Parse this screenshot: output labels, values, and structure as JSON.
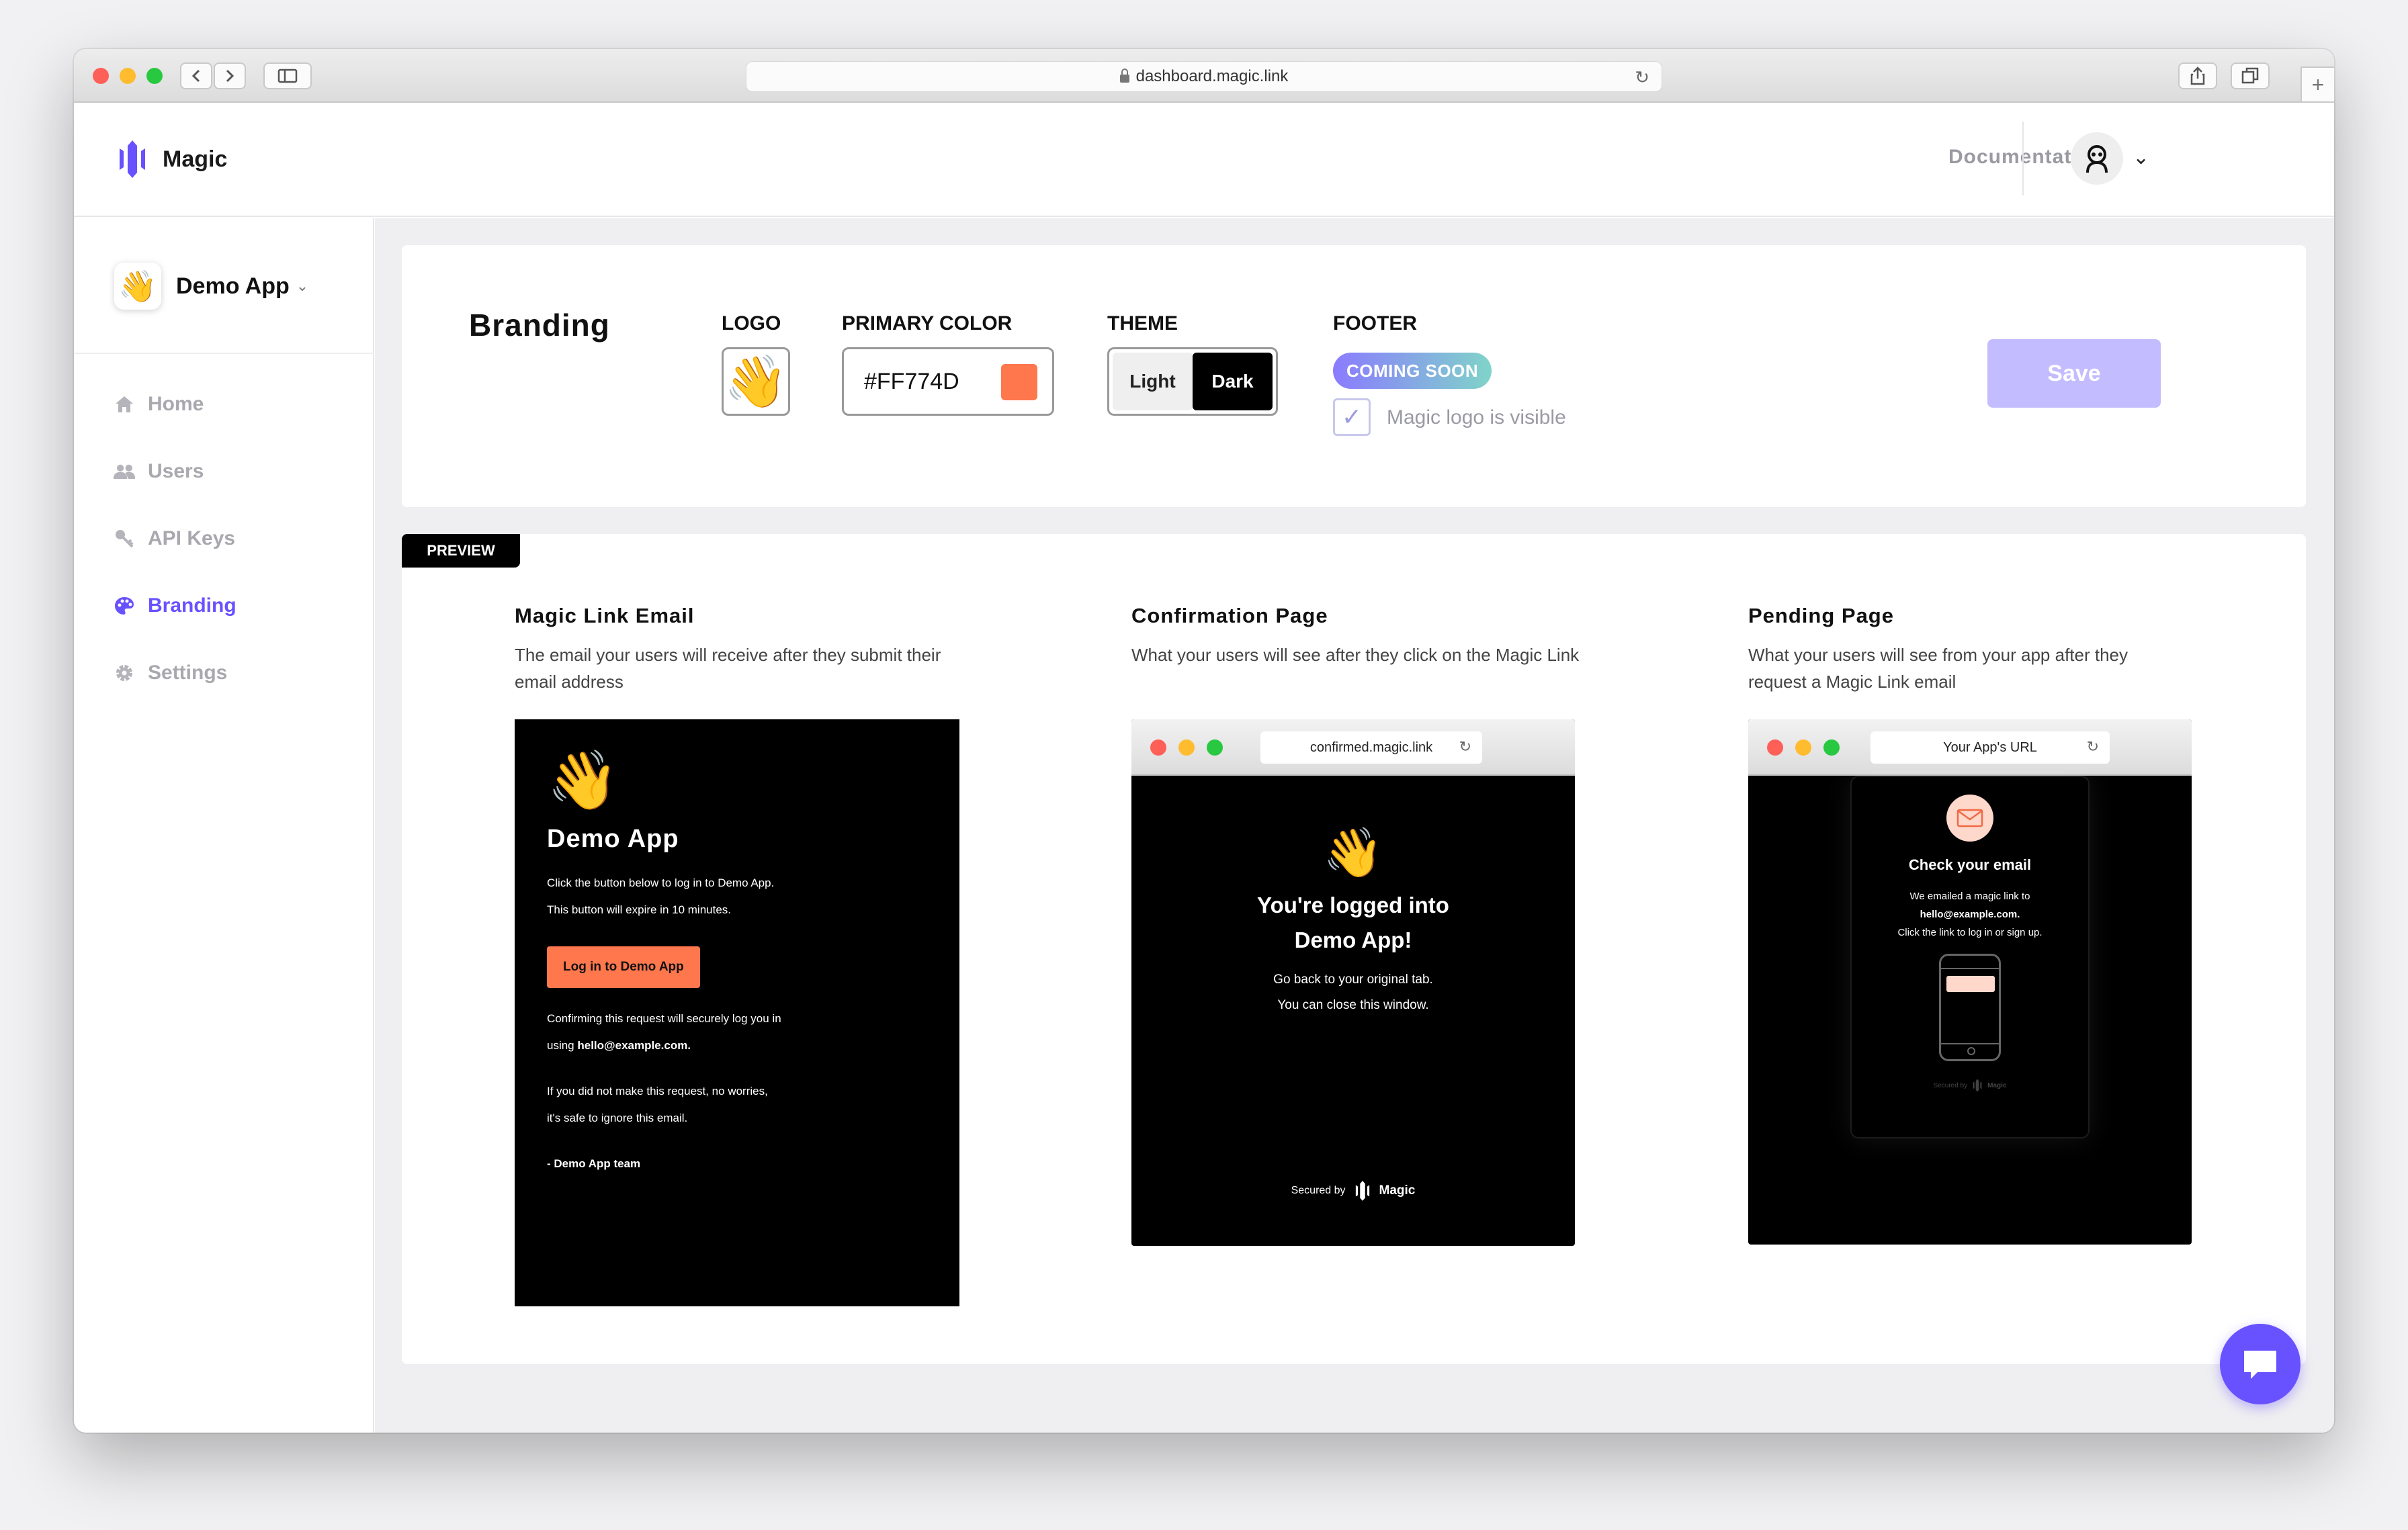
{
  "browser": {
    "url": "dashboard.magic.link"
  },
  "header": {
    "brand": "Magic",
    "documentation": "Documentation"
  },
  "sidebar": {
    "app_name": "Demo App",
    "items": [
      {
        "label": "Home",
        "icon": "home-icon",
        "active": false
      },
      {
        "label": "Users",
        "icon": "users-icon",
        "active": false
      },
      {
        "label": "API Keys",
        "icon": "key-icon",
        "active": false
      },
      {
        "label": "Branding",
        "icon": "palette-icon",
        "active": true
      },
      {
        "label": "Settings",
        "icon": "gear-icon",
        "active": false
      }
    ]
  },
  "branding": {
    "title": "Branding",
    "logo_label": "LOGO",
    "primary_color_label": "PRIMARY COLOR",
    "primary_color_value": "#FF774D",
    "theme_label": "THEME",
    "theme_light": "Light",
    "theme_dark": "Dark",
    "theme_selected": "Dark",
    "footer_label": "FOOTER",
    "coming_soon": "COMING SOON",
    "logo_visible_label": "Magic logo is visible",
    "logo_visible_checked": true,
    "save": "Save"
  },
  "preview": {
    "tag": "PREVIEW",
    "email": {
      "title": "Magic Link Email",
      "desc": "The email your users will receive after they submit their email address",
      "app_name": "Demo App",
      "line1": "Click the button below to log in to Demo App.",
      "line2": "This button will expire in 10 minutes.",
      "button": "Log in to Demo App",
      "confirm1": "Confirming this request will securely log you in",
      "confirm2_prefix": "using",
      "email_addr": "hello@example.com.",
      "ignore1": "If you did not make this request, no worries,",
      "ignore2": "it's safe to ignore this email.",
      "signoff": "- Demo App team"
    },
    "confirmation": {
      "title": "Confirmation Page",
      "desc": "What your users will see after they click on the Magic Link",
      "url": "confirmed.magic.link",
      "heading1": "You're logged into",
      "heading2": "Demo App!",
      "line1": "Go back to your original tab.",
      "line2": "You can close this window.",
      "secured": "Secured by",
      "brand": "Magic"
    },
    "pending": {
      "title": "Pending Page",
      "desc": "What your users will see from your app after they request a Magic Link email",
      "url": "Your App's URL",
      "heading": "Check your email",
      "line1": "We emailed a magic link to",
      "email_addr": "hello@example.com.",
      "line2": "Click the link to log in or sign up.",
      "secured": "Secured by",
      "brand": "Magic"
    }
  },
  "colors": {
    "accent": "#6851ff",
    "primary": "#FF774D"
  }
}
